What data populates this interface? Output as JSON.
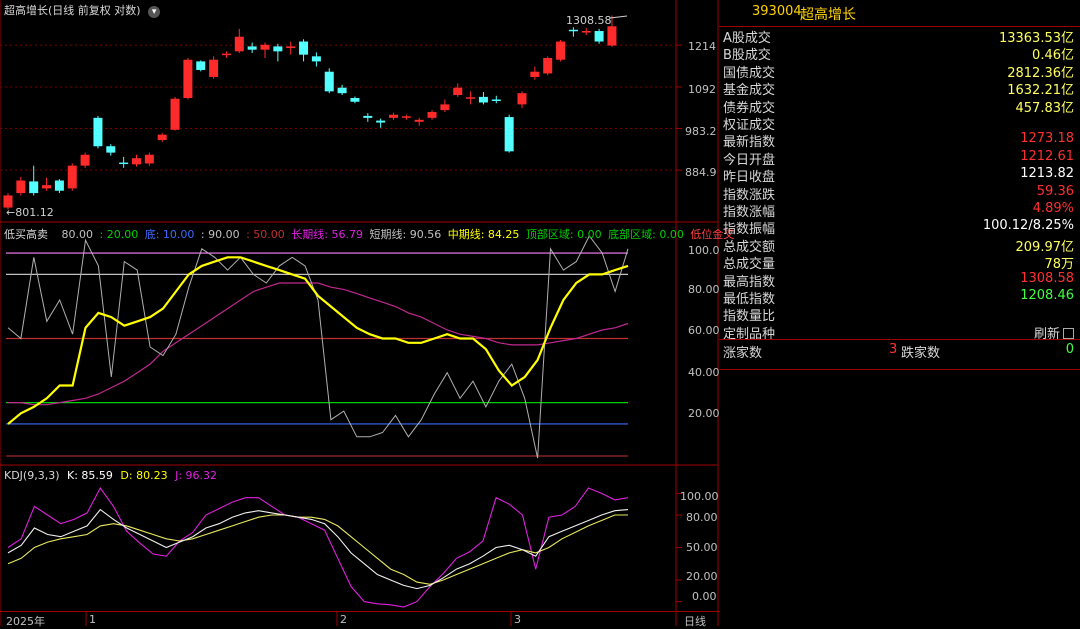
{
  "colors": {
    "up": "#ff2b2b",
    "down": "#54ffff",
    "yellow": "#ffff00",
    "magenta": "#e020e0",
    "green": "#00d000",
    "blue": "#3a6bff",
    "frame": "#a00000"
  },
  "main_panel": {
    "title": "超高增长(日线 前复权 对数)",
    "high_label": "1308.58",
    "low_label": "801.12",
    "y_ticks": [
      "1214",
      "1092",
      "983.2",
      "884.9"
    ]
  },
  "ind_panel": {
    "name": "低买高卖",
    "items": [
      {
        "text": "80.00",
        "color": "#c0c0c0"
      },
      {
        "text": ": 20.00",
        "color": "#00d000"
      },
      {
        "text": "底: 10.00",
        "color": "#3a6bff"
      },
      {
        "text": ": 90.00",
        "color": "#c0c0c0"
      },
      {
        "text": ": 50.00",
        "color": "#c03030"
      },
      {
        "text": "长期线: 56.79",
        "color": "#e020e0"
      },
      {
        "text": "短期线: 90.56",
        "color": "#c0c0c0"
      },
      {
        "text": "中期线: 84.25",
        "color": "#ffff00"
      },
      {
        "text": "顶部区域: 0.00",
        "color": "#00d000"
      },
      {
        "text": "底部区域: 0.00",
        "color": "#00d000"
      },
      {
        "text": "低位金叉",
        "color": "#ff4040"
      }
    ],
    "y_ticks": [
      "100.0",
      "80.00",
      "60.00",
      "40.00",
      "20.00"
    ]
  },
  "kdj_panel": {
    "name": "KDJ(9,3,3)",
    "k": "K: 85.59",
    "d": "D: 80.23",
    "j": "J: 96.32",
    "y_ticks": [
      "100.00",
      "80.00",
      "50.00",
      "20.00",
      "0.00"
    ]
  },
  "time_axis": {
    "labels": [
      "2025年",
      "1",
      "2",
      "3"
    ],
    "period": "日线"
  },
  "info": {
    "code": "393004",
    "name": "超高增长",
    "rows": [
      {
        "k": "A股成交",
        "v": "13363.53亿",
        "c": "#ffff60"
      },
      {
        "k": "B股成交",
        "v": "0.46亿",
        "c": "#ffff60"
      },
      {
        "k": "国债成交",
        "v": "2812.36亿",
        "c": "#ffff60"
      },
      {
        "k": "基金成交",
        "v": "1632.21亿",
        "c": "#ffff60"
      },
      {
        "k": "债券成交",
        "v": "457.83亿",
        "c": "#ffff60"
      },
      {
        "k": "权证成交",
        "v": "",
        "c": "#ffff60"
      },
      {
        "k": "最新指数",
        "v": "1273.18",
        "c": "#ff3030"
      },
      {
        "k": "今日开盘",
        "v": "1212.61",
        "c": "#ff3030"
      },
      {
        "k": "昨日收盘",
        "v": "1213.82",
        "c": "#ffffff"
      },
      {
        "k": "指数涨跌",
        "v": "59.36",
        "c": "#ff3030"
      },
      {
        "k": "指数涨幅",
        "v": "4.89%",
        "c": "#ff3030"
      },
      {
        "k": "指数振幅",
        "v": "100.12/8.25%",
        "c": "#ffffff"
      },
      {
        "k": "总成交额",
        "v": "209.97亿",
        "c": "#ffff60"
      },
      {
        "k": "总成交量",
        "v": "78万",
        "c": "#ffff60"
      },
      {
        "k": "最高指数",
        "v": "1308.58",
        "c": "#ff3030"
      },
      {
        "k": "最低指数",
        "v": "1208.46",
        "c": "#40ff40"
      },
      {
        "k": "指数量比",
        "v": "",
        "c": "#ffffff"
      },
      {
        "k": "定制品种",
        "v": "刷新",
        "c": "#d8d8d8"
      }
    ],
    "adv_label": "涨家数",
    "adv_value": "3",
    "dec_label": "跌家数",
    "dec_value": "0"
  },
  "chart_data": {
    "type": "candlestick",
    "high": 1308.58,
    "low": 801.12,
    "candles": [
      {
        "o": 805,
        "c": 830,
        "h": 835,
        "l": 801.12
      },
      {
        "o": 835,
        "c": 862,
        "h": 870,
        "l": 830
      },
      {
        "o": 860,
        "c": 835,
        "h": 895,
        "l": 830
      },
      {
        "o": 845,
        "c": 852,
        "h": 868,
        "l": 840
      },
      {
        "o": 862,
        "c": 840,
        "h": 865,
        "l": 835
      },
      {
        "o": 845,
        "c": 895,
        "h": 900,
        "l": 840
      },
      {
        "o": 895,
        "c": 920,
        "h": 925,
        "l": 890
      },
      {
        "o": 1010,
        "c": 940,
        "h": 1015,
        "l": 935
      },
      {
        "o": 940,
        "c": 925,
        "h": 945,
        "l": 918
      },
      {
        "o": 902,
        "c": 900,
        "h": 915,
        "l": 890
      },
      {
        "o": 898,
        "c": 912,
        "h": 920,
        "l": 893
      },
      {
        "o": 900,
        "c": 920,
        "h": 925,
        "l": 895
      },
      {
        "o": 955,
        "c": 968,
        "h": 972,
        "l": 950
      },
      {
        "o": 980,
        "c": 1060,
        "h": 1065,
        "l": 978
      },
      {
        "o": 1062,
        "c": 1170,
        "h": 1175,
        "l": 1058
      },
      {
        "o": 1165,
        "c": 1140,
        "h": 1168,
        "l": 1136
      },
      {
        "o": 1120,
        "c": 1170,
        "h": 1180,
        "l": 1115
      },
      {
        "o": 1185,
        "c": 1188,
        "h": 1195,
        "l": 1175
      },
      {
        "o": 1195,
        "c": 1240,
        "h": 1265,
        "l": 1190
      },
      {
        "o": 1210,
        "c": 1200,
        "h": 1222,
        "l": 1190
      },
      {
        "o": 1200,
        "c": 1215,
        "h": 1222,
        "l": 1175
      },
      {
        "o": 1210,
        "c": 1195,
        "h": 1218,
        "l": 1165
      },
      {
        "o": 1205,
        "c": 1210,
        "h": 1225,
        "l": 1185
      },
      {
        "o": 1225,
        "c": 1185,
        "h": 1232,
        "l": 1165
      },
      {
        "o": 1180,
        "c": 1165,
        "h": 1192,
        "l": 1150
      },
      {
        "o": 1135,
        "c": 1080,
        "h": 1145,
        "l": 1075
      },
      {
        "o": 1090,
        "c": 1075,
        "h": 1098,
        "l": 1070
      },
      {
        "o": 1062,
        "c": 1052,
        "h": 1066,
        "l": 1048
      },
      {
        "o": 1015,
        "c": 1010,
        "h": 1022,
        "l": 1000
      },
      {
        "o": 1003,
        "c": 998,
        "h": 1008,
        "l": 985
      },
      {
        "o": 1010,
        "c": 1018,
        "h": 1023,
        "l": 1005
      },
      {
        "o": 1012,
        "c": 1014,
        "h": 1018,
        "l": 1005
      },
      {
        "o": 1000,
        "c": 1005,
        "h": 1010,
        "l": 990
      },
      {
        "o": 1010,
        "c": 1025,
        "h": 1030,
        "l": 1005
      },
      {
        "o": 1030,
        "c": 1045,
        "h": 1058,
        "l": 1025
      },
      {
        "o": 1070,
        "c": 1090,
        "h": 1102,
        "l": 1065
      },
      {
        "o": 1060,
        "c": 1064,
        "h": 1080,
        "l": 1045
      },
      {
        "o": 1065,
        "c": 1050,
        "h": 1078,
        "l": 1045
      },
      {
        "o": 1058,
        "c": 1056,
        "h": 1068,
        "l": 1048
      },
      {
        "o": 1012,
        "c": 928,
        "h": 1018,
        "l": 925
      },
      {
        "o": 1045,
        "c": 1075,
        "h": 1080,
        "l": 1035
      },
      {
        "o": 1120,
        "c": 1135,
        "h": 1150,
        "l": 1112
      },
      {
        "o": 1130,
        "c": 1175,
        "h": 1180,
        "l": 1125
      },
      {
        "o": 1170,
        "c": 1225,
        "h": 1230,
        "l": 1165
      },
      {
        "o": 1262,
        "c": 1258,
        "h": 1270,
        "l": 1240
      },
      {
        "o": 1255,
        "c": 1258,
        "h": 1268,
        "l": 1245
      },
      {
        "o": 1258,
        "c": 1225,
        "h": 1265,
        "l": 1218
      },
      {
        "o": 1212.61,
        "c": 1273.18,
        "h": 1308.58,
        "l": 1208.46
      }
    ],
    "indicator": {
      "levels": {
        "top": 90,
        "upper": 80,
        "mid": 50,
        "lower": 20,
        "bottom": 10
      },
      "short": [
        55,
        50,
        88,
        58,
        68,
        52,
        96,
        84,
        32,
        86,
        82,
        46,
        42,
        52,
        74,
        92,
        88,
        82,
        88,
        80,
        76,
        84,
        88,
        84,
        68,
        12,
        16,
        4,
        4,
        6,
        14,
        4,
        12,
        24,
        34,
        22,
        30,
        18,
        30,
        38,
        22,
        -6,
        92,
        82,
        86,
        98,
        90,
        72,
        92
      ],
      "mid": [
        10,
        15,
        18,
        22,
        28,
        28,
        55,
        62,
        60,
        56,
        58,
        60,
        64,
        72,
        80,
        84,
        86,
        88,
        88,
        86,
        84,
        82,
        80,
        78,
        70,
        65,
        60,
        55,
        52,
        50,
        50,
        48,
        48,
        50,
        52,
        50,
        50,
        45,
        35,
        28,
        32,
        40,
        55,
        68,
        76,
        80,
        80,
        82,
        84
      ],
      "long": [
        20,
        20,
        19,
        19,
        20,
        21,
        22,
        24,
        27,
        30,
        34,
        38,
        44,
        48,
        52,
        56,
        60,
        64,
        68,
        72,
        74,
        76,
        76,
        76,
        76,
        74,
        73,
        71,
        69,
        67,
        65,
        62,
        60,
        57,
        54,
        52,
        51,
        50,
        48,
        47,
        47,
        47,
        48,
        49,
        50,
        52,
        54,
        55,
        57
      ]
    },
    "kdj": {
      "K": [
        45,
        52,
        68,
        62,
        60,
        65,
        70,
        85,
        76,
        68,
        62,
        56,
        50,
        55,
        60,
        68,
        72,
        78,
        82,
        84,
        82,
        80,
        78,
        76,
        72,
        60,
        45,
        35,
        25,
        20,
        15,
        12,
        15,
        22,
        30,
        35,
        42,
        50,
        52,
        48,
        42,
        60,
        65,
        70,
        75,
        80,
        84,
        85
      ],
      "D": [
        35,
        40,
        50,
        55,
        58,
        60,
        62,
        70,
        72,
        70,
        66,
        62,
        58,
        56,
        58,
        62,
        66,
        70,
        74,
        78,
        80,
        80,
        78,
        78,
        76,
        70,
        60,
        50,
        40,
        30,
        25,
        18,
        16,
        20,
        25,
        30,
        35,
        40,
        45,
        48,
        45,
        50,
        58,
        64,
        70,
        75,
        80,
        80
      ],
      "J": [
        50,
        58,
        88,
        80,
        72,
        76,
        82,
        105,
        88,
        65,
        54,
        44,
        42,
        56,
        64,
        80,
        86,
        92,
        96,
        96,
        88,
        80,
        78,
        72,
        66,
        40,
        14,
        0,
        -2,
        -3,
        -5,
        0,
        14,
        26,
        40,
        46,
        56,
        96,
        90,
        80,
        30,
        78,
        80,
        88,
        105,
        100,
        94,
        96
      ]
    }
  }
}
